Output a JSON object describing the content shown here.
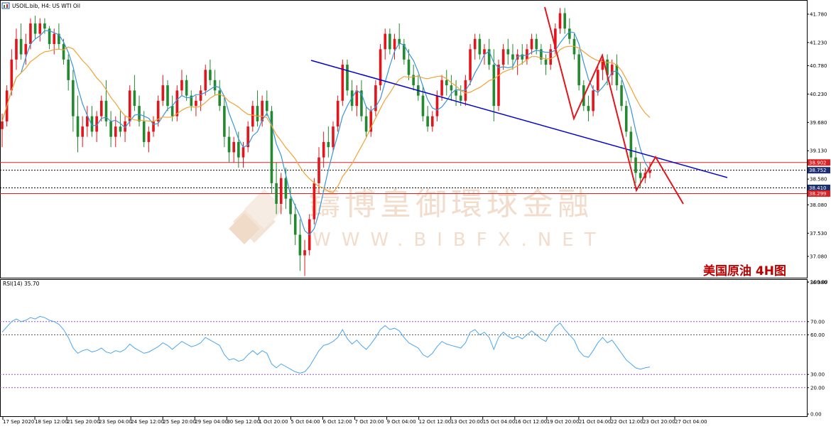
{
  "header": {
    "icon": "chart-window-icon",
    "title": "USOIL.bib, H4: US WTI Oil",
    "rsi_label": "RSI(14) 35.70"
  },
  "watermark": {
    "cn": "鑄博皇御環球金融",
    "en": "WWW.BIBFX.NET",
    "logo": "bibfx-diamond-logo"
  },
  "annotation": "美国原油 4H图",
  "colors": {
    "bull": "#e3151a",
    "bear": "#23892f",
    "ma_fast": "#3895d8",
    "ma_slow": "#f2a233",
    "trendline": "#0000d4",
    "red_lines": "#e02020",
    "rsi": "#4aa6ee",
    "rsi_levels": "#9c4fd0"
  },
  "chart_data": {
    "type": "candlestick",
    "symbol": "USOIL.bib",
    "timeframe": "H4",
    "ylim": [
      36.68,
      42.0
    ],
    "y_ticks": [
      "41.780",
      "41.230",
      "40.780",
      "40.230",
      "39.680",
      "39.130",
      "38.580",
      "38.080",
      "37.530",
      "37.080",
      "36.980"
    ],
    "y_tick_values": [
      41.78,
      41.23,
      40.78,
      40.23,
      39.68,
      39.13,
      38.58,
      38.08,
      37.53,
      37.08,
      36.58
    ],
    "x_labels": [
      "17 Sep 2020",
      "18 Sep 12:00",
      "21 Sep 20:00",
      "23 Sep 04:00",
      "24 Sep 12:00",
      "25 Sep 20:00",
      "29 Sep 04:00",
      "30 Sep 12:00",
      "1 Oct 20:00",
      "5 Oct 04:00",
      "6 Oct 12:00",
      "7 Oct 20:00",
      "9 Oct 04:00",
      "12 Oct 12:00",
      "13 Oct 20:00",
      "15 Oct 04:00",
      "16 Oct 12:00",
      "19 Oct 20:00",
      "21 Oct 04:00",
      "22 Oct 12:00",
      "23 Oct 20:00",
      "27 Oct 04:00"
    ],
    "price_levels": [
      {
        "value": 38.902,
        "label": "38.902",
        "style": "solid",
        "color": "#e02020"
      },
      {
        "value": 38.752,
        "label": "38.752",
        "style": "dotted",
        "color": "#000000"
      },
      {
        "value": 38.41,
        "label": "38.410",
        "style": "dotted",
        "color": "#000000"
      },
      {
        "value": 38.299,
        "label": "38.299",
        "style": "solid",
        "color": "#e02020"
      }
    ],
    "ohlc": [
      [
        39.55,
        39.85,
        39.2,
        39.7
      ],
      [
        39.7,
        40.4,
        39.6,
        40.3
      ],
      [
        40.3,
        41.1,
        40.2,
        40.9
      ],
      [
        40.9,
        41.5,
        40.7,
        41.3
      ],
      [
        41.3,
        41.6,
        40.9,
        41.0
      ],
      [
        41.0,
        41.4,
        40.8,
        41.2
      ],
      [
        41.2,
        41.7,
        41.1,
        41.6
      ],
      [
        41.6,
        41.75,
        41.3,
        41.4
      ],
      [
        41.4,
        41.7,
        41.25,
        41.6
      ],
      [
        41.6,
        41.7,
        41.4,
        41.5
      ],
      [
        41.5,
        41.55,
        41.1,
        41.2
      ],
      [
        41.2,
        41.5,
        41.0,
        41.4
      ],
      [
        41.4,
        41.6,
        41.1,
        41.2
      ],
      [
        41.2,
        41.3,
        40.8,
        40.9
      ],
      [
        40.9,
        41.0,
        40.3,
        40.5
      ],
      [
        40.5,
        40.7,
        39.5,
        39.8
      ],
      [
        39.8,
        40.2,
        39.1,
        39.4
      ],
      [
        39.4,
        39.8,
        39.2,
        39.6
      ],
      [
        39.6,
        40.0,
        39.4,
        39.8
      ],
      [
        39.8,
        40.0,
        39.4,
        39.5
      ],
      [
        39.5,
        39.9,
        39.3,
        39.8
      ],
      [
        39.8,
        40.2,
        39.7,
        40.1
      ],
      [
        40.1,
        40.5,
        39.6,
        39.7
      ],
      [
        39.7,
        39.9,
        39.2,
        39.4
      ],
      [
        39.4,
        39.8,
        39.2,
        39.6
      ],
      [
        39.6,
        39.9,
        39.4,
        39.5
      ],
      [
        39.5,
        39.8,
        39.3,
        39.7
      ],
      [
        39.7,
        40.4,
        39.6,
        40.3
      ],
      [
        40.3,
        40.6,
        39.9,
        40.0
      ],
      [
        40.0,
        40.2,
        39.6,
        39.7
      ],
      [
        39.7,
        39.9,
        39.2,
        39.3
      ],
      [
        39.3,
        39.6,
        39.1,
        39.5
      ],
      [
        39.5,
        39.8,
        39.4,
        39.7
      ],
      [
        39.7,
        40.2,
        39.6,
        40.1
      ],
      [
        40.1,
        40.6,
        40.0,
        40.4
      ],
      [
        40.4,
        40.5,
        39.9,
        40.0
      ],
      [
        40.0,
        40.2,
        39.7,
        39.8
      ],
      [
        39.8,
        40.4,
        39.7,
        40.3
      ],
      [
        40.3,
        40.7,
        40.2,
        40.5
      ],
      [
        40.5,
        40.6,
        40.1,
        40.2
      ],
      [
        40.2,
        40.3,
        39.9,
        40.0
      ],
      [
        40.0,
        40.2,
        39.8,
        40.1
      ],
      [
        40.1,
        40.4,
        39.9,
        40.3
      ],
      [
        40.3,
        40.8,
        40.2,
        40.7
      ],
      [
        40.7,
        40.9,
        40.4,
        40.5
      ],
      [
        40.5,
        40.7,
        40.2,
        40.3
      ],
      [
        40.3,
        40.5,
        39.9,
        40.0
      ],
      [
        40.0,
        40.2,
        39.2,
        39.4
      ],
      [
        39.4,
        39.6,
        38.9,
        39.1
      ],
      [
        39.1,
        39.4,
        38.9,
        39.3
      ],
      [
        39.3,
        39.5,
        38.8,
        39.0
      ],
      [
        39.0,
        39.3,
        38.8,
        39.2
      ],
      [
        39.2,
        39.7,
        39.1,
        39.6
      ],
      [
        39.6,
        40.1,
        39.5,
        40.0
      ],
      [
        40.0,
        40.3,
        39.6,
        39.7
      ],
      [
        39.7,
        40.2,
        39.6,
        40.1
      ],
      [
        40.1,
        40.3,
        39.8,
        39.9
      ],
      [
        39.9,
        40.0,
        38.3,
        38.5
      ],
      [
        38.5,
        38.9,
        37.9,
        38.1
      ],
      [
        38.1,
        38.7,
        37.9,
        38.6
      ],
      [
        38.6,
        38.8,
        38.0,
        38.2
      ],
      [
        38.2,
        38.4,
        37.7,
        37.9
      ],
      [
        37.9,
        38.1,
        37.3,
        37.5
      ],
      [
        37.5,
        37.8,
        36.8,
        37.1
      ],
      [
        37.1,
        37.4,
        36.7,
        37.2
      ],
      [
        37.2,
        37.9,
        37.1,
        37.8
      ],
      [
        37.8,
        38.6,
        37.7,
        38.5
      ],
      [
        38.5,
        39.2,
        38.3,
        39.0
      ],
      [
        39.0,
        39.5,
        38.8,
        39.3
      ],
      [
        39.3,
        39.6,
        39.0,
        39.2
      ],
      [
        39.2,
        39.7,
        39.1,
        39.6
      ],
      [
        39.6,
        40.2,
        39.5,
        40.1
      ],
      [
        40.1,
        40.9,
        40.0,
        40.8
      ],
      [
        40.8,
        40.9,
        40.2,
        40.3
      ],
      [
        40.3,
        40.5,
        39.9,
        40.0
      ],
      [
        40.0,
        40.4,
        39.8,
        40.3
      ],
      [
        40.3,
        40.5,
        39.7,
        39.8
      ],
      [
        39.8,
        40.0,
        39.4,
        39.5
      ],
      [
        39.5,
        40.0,
        39.4,
        39.9
      ],
      [
        39.9,
        40.5,
        39.8,
        40.4
      ],
      [
        40.4,
        41.2,
        40.3,
        41.1
      ],
      [
        41.1,
        41.5,
        40.9,
        41.4
      ],
      [
        41.4,
        41.5,
        41.0,
        41.1
      ],
      [
        41.1,
        41.4,
        40.9,
        41.3
      ],
      [
        41.3,
        41.6,
        41.1,
        41.2
      ],
      [
        41.2,
        41.3,
        40.8,
        40.9
      ],
      [
        40.9,
        41.1,
        40.5,
        40.6
      ],
      [
        40.6,
        40.8,
        40.3,
        40.4
      ],
      [
        40.4,
        40.6,
        40.1,
        40.2
      ],
      [
        40.2,
        40.4,
        39.7,
        39.8
      ],
      [
        39.8,
        40.0,
        39.5,
        39.6
      ],
      [
        39.6,
        39.9,
        39.5,
        39.8
      ],
      [
        39.8,
        40.3,
        39.7,
        40.2
      ],
      [
        40.2,
        40.6,
        40.1,
        40.5
      ],
      [
        40.5,
        40.7,
        40.2,
        40.4
      ],
      [
        40.4,
        40.6,
        40.1,
        40.3
      ],
      [
        40.3,
        40.5,
        40.0,
        40.2
      ],
      [
        40.2,
        40.4,
        40.0,
        40.1
      ],
      [
        40.1,
        40.6,
        40.0,
        40.5
      ],
      [
        40.5,
        41.2,
        40.4,
        41.1
      ],
      [
        41.1,
        41.4,
        40.9,
        41.3
      ],
      [
        41.3,
        41.4,
        40.9,
        41.0
      ],
      [
        41.0,
        41.2,
        40.8,
        41.1
      ],
      [
        41.1,
        41.3,
        40.7,
        40.8
      ],
      [
        40.8,
        41.1,
        39.7,
        40.0
      ],
      [
        40.0,
        40.9,
        39.9,
        40.8
      ],
      [
        40.8,
        41.2,
        40.7,
        41.1
      ],
      [
        41.1,
        41.3,
        40.8,
        41.0
      ],
      [
        41.0,
        41.2,
        40.7,
        40.9
      ],
      [
        40.9,
        41.1,
        40.6,
        41.0
      ],
      [
        41.0,
        41.2,
        40.8,
        40.9
      ],
      [
        40.9,
        41.2,
        40.8,
        41.1
      ],
      [
        41.1,
        41.4,
        41.0,
        41.3
      ],
      [
        41.3,
        41.4,
        41.0,
        41.1
      ],
      [
        41.1,
        41.2,
        40.8,
        40.9
      ],
      [
        40.9,
        41.0,
        40.6,
        40.8
      ],
      [
        40.8,
        41.2,
        40.7,
        41.1
      ],
      [
        41.1,
        41.6,
        41.0,
        41.5
      ],
      [
        41.5,
        41.9,
        41.4,
        41.8
      ],
      [
        41.8,
        41.9,
        41.4,
        41.5
      ],
      [
        41.5,
        41.7,
        41.2,
        41.3
      ],
      [
        41.3,
        41.4,
        40.9,
        41.0
      ],
      [
        41.0,
        41.1,
        40.3,
        40.4
      ],
      [
        40.4,
        40.5,
        39.9,
        40.0
      ],
      [
        40.0,
        40.2,
        39.7,
        39.9
      ],
      [
        39.9,
        40.4,
        39.8,
        40.3
      ],
      [
        40.3,
        40.8,
        40.2,
        40.7
      ],
      [
        40.7,
        41.0,
        40.5,
        40.9
      ],
      [
        40.9,
        41.0,
        40.4,
        40.6
      ],
      [
        40.6,
        40.9,
        40.4,
        40.8
      ],
      [
        40.8,
        41.0,
        40.3,
        40.4
      ],
      [
        40.4,
        40.5,
        39.9,
        40.0
      ],
      [
        40.0,
        40.1,
        39.4,
        39.5
      ],
      [
        39.5,
        39.6,
        38.9,
        39.0
      ],
      [
        39.0,
        39.2,
        38.5,
        38.7
      ],
      [
        38.7,
        38.9,
        38.4,
        38.6
      ],
      [
        38.6,
        38.8,
        38.5,
        38.7
      ],
      [
        38.7,
        38.9,
        38.6,
        38.75
      ]
    ],
    "rsi": {
      "name": "RSI(14)",
      "last": 35.7,
      "ylim": [
        0,
        100
      ],
      "y_ticks": [
        "100.00",
        "70.00",
        "60.00",
        "30.00",
        "20.00",
        "0.00"
      ],
      "levels": [
        70,
        60,
        30,
        20
      ],
      "values": [
        62,
        66,
        70,
        72,
        70,
        71,
        73,
        72,
        74,
        73,
        71,
        70,
        68,
        64,
        58,
        50,
        46,
        48,
        49,
        47,
        48,
        50,
        47,
        46,
        48,
        47,
        49,
        53,
        50,
        48,
        46,
        47,
        49,
        51,
        54,
        52,
        49,
        52,
        55,
        53,
        51,
        52,
        54,
        58,
        56,
        54,
        52,
        45,
        41,
        42,
        40,
        41,
        45,
        48,
        45,
        48,
        46,
        38,
        35,
        38,
        36,
        34,
        32,
        31,
        32,
        36,
        42,
        48,
        52,
        53,
        55,
        58,
        64,
        57,
        53,
        56,
        52,
        49,
        53,
        58,
        64,
        67,
        64,
        65,
        63,
        58,
        54,
        52,
        50,
        45,
        43,
        46,
        51,
        55,
        53,
        52,
        51,
        50,
        54,
        62,
        64,
        60,
        62,
        58,
        49,
        58,
        62,
        59,
        57,
        59,
        57,
        60,
        63,
        60,
        57,
        55,
        61,
        66,
        69,
        64,
        60,
        56,
        48,
        44,
        43,
        48,
        54,
        58,
        54,
        56,
        51,
        46,
        41,
        38,
        35,
        34,
        35,
        35.7
      ]
    }
  }
}
